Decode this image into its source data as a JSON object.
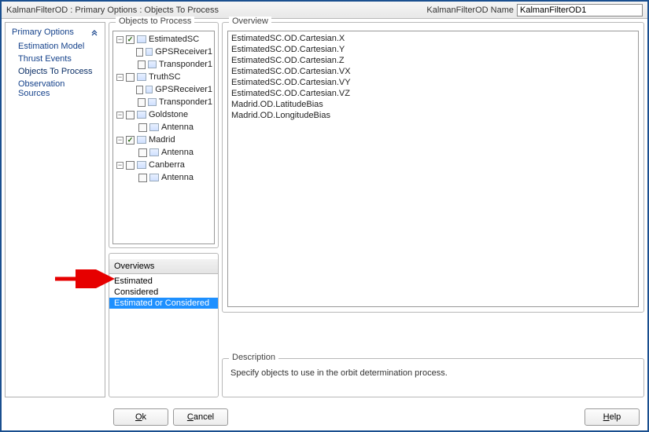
{
  "titlebar": {
    "title": "KalmanFilterOD : Primary Options : Objects To Process",
    "name_label": "KalmanFilterOD Name",
    "name_value": "KalmanFilterOD1"
  },
  "sidebar": {
    "header": "Primary Options",
    "items": [
      {
        "label": "Estimation Model",
        "selected": false
      },
      {
        "label": "Thrust Events",
        "selected": false
      },
      {
        "label": "Objects To Process",
        "selected": true
      },
      {
        "label": "Observation Sources",
        "selected": false
      }
    ]
  },
  "objects_panel": {
    "legend": "Objects to Process",
    "tree": [
      {
        "level": 0,
        "expander": "-",
        "checked": true,
        "label": "EstimatedSC"
      },
      {
        "level": 1,
        "expander": "",
        "checked": false,
        "label": "GPSReceiver1"
      },
      {
        "level": 1,
        "expander": "",
        "checked": false,
        "label": "Transponder1"
      },
      {
        "level": 0,
        "expander": "-",
        "checked": false,
        "label": "TruthSC"
      },
      {
        "level": 1,
        "expander": "",
        "checked": false,
        "label": "GPSReceiver1"
      },
      {
        "level": 1,
        "expander": "",
        "checked": false,
        "label": "Transponder1"
      },
      {
        "level": 0,
        "expander": "-",
        "checked": false,
        "label": "Goldstone"
      },
      {
        "level": 1,
        "expander": "",
        "checked": false,
        "label": "Antenna"
      },
      {
        "level": 0,
        "expander": "-",
        "checked": true,
        "label": "Madrid"
      },
      {
        "level": 1,
        "expander": "",
        "checked": false,
        "label": "Antenna"
      },
      {
        "level": 0,
        "expander": "-",
        "checked": false,
        "label": "Canberra"
      },
      {
        "level": 1,
        "expander": "",
        "checked": false,
        "label": "Antenna"
      }
    ]
  },
  "overviews_panel": {
    "header": "Overviews",
    "items": [
      {
        "label": "Estimated",
        "selected": false
      },
      {
        "label": "Considered",
        "selected": false
      },
      {
        "label": "Estimated or Considered",
        "selected": true
      }
    ]
  },
  "overview_panel": {
    "legend": "Overview",
    "rows": [
      "EstimatedSC.OD.Cartesian.X",
      "EstimatedSC.OD.Cartesian.Y",
      "EstimatedSC.OD.Cartesian.Z",
      "EstimatedSC.OD.Cartesian.VX",
      "EstimatedSC.OD.Cartesian.VY",
      "EstimatedSC.OD.Cartesian.VZ",
      "Madrid.OD.LatitudeBias",
      "Madrid.OD.LongitudeBias"
    ]
  },
  "description": {
    "legend": "Description",
    "text": "Specify objects to use in the orbit determination process."
  },
  "buttons": {
    "ok": "Ok",
    "cancel": "Cancel",
    "help": "Help"
  },
  "colors": {
    "accent": "#15428b",
    "selection": "#1e90ff",
    "arrow": "#e60000"
  }
}
